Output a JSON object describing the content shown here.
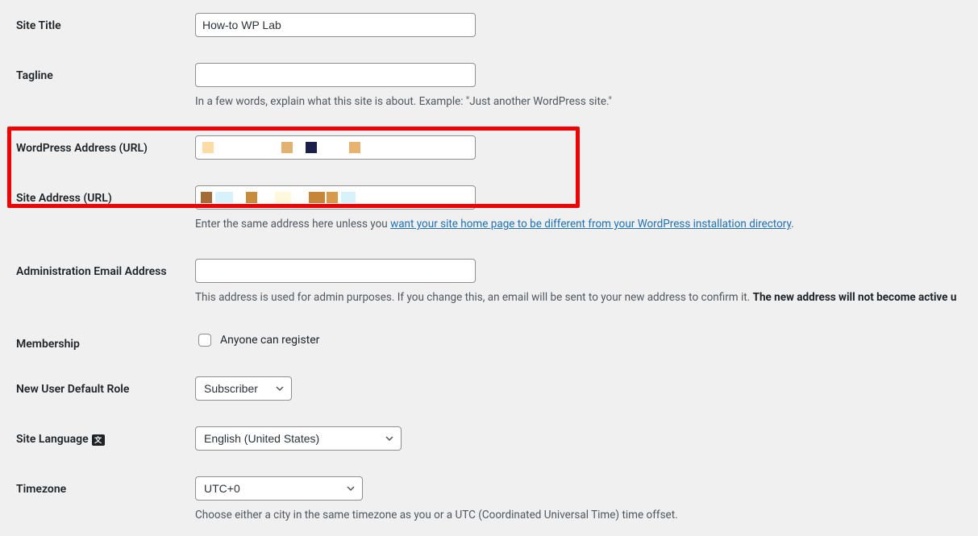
{
  "fields": {
    "site_title": {
      "label": "Site Title",
      "value": "How-to WP Lab"
    },
    "tagline": {
      "label": "Tagline",
      "value": "",
      "help": "In a few words, explain what this site is about. Example: \"Just another WordPress site.\""
    },
    "wp_address": {
      "label": "WordPress Address (URL)",
      "value": ""
    },
    "site_address": {
      "label": "Site Address (URL)",
      "value": "",
      "help_prefix": "Enter the same address here unless you ",
      "help_link": "want your site home page to be different from your WordPress installation directory",
      "help_suffix": "."
    },
    "admin_email": {
      "label": "Administration Email Address",
      "value": "",
      "help_prefix": "This address is used for admin purposes. If you change this, an email will be sent to your new address to confirm it. ",
      "help_strong": "The new address will not become active u"
    },
    "membership": {
      "label": "Membership",
      "checkbox_label": "Anyone can register",
      "checked": false
    },
    "default_role": {
      "label": "New User Default Role",
      "value": "Subscriber"
    },
    "site_language": {
      "label": "Site Language",
      "value": "English (United States)"
    },
    "timezone": {
      "label": "Timezone",
      "value": "UTC+0",
      "help": "Choose either a city in the same timezone as you or a UTC (Coordinated Universal Time) time offset."
    }
  },
  "highlight": true
}
